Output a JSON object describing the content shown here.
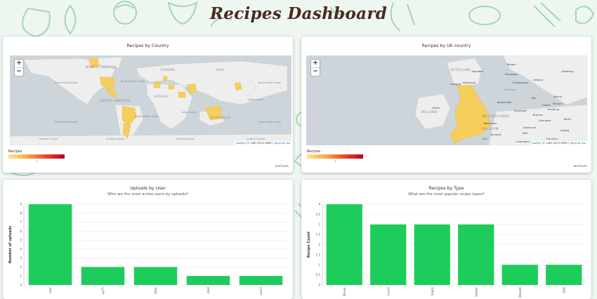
{
  "page": {
    "title": "Recipes Dashboard"
  },
  "colors": {
    "bar": "#1ecc5c",
    "doodle": "#7fc59a",
    "title": "#4a2a22",
    "map_highlight": "#f5cf5c"
  },
  "maps": [
    {
      "title": "Recipes by Country",
      "zoom_in": "+",
      "zoom_out": "−",
      "attribution": {
        "prefix": "Leaflet",
        "middle": " | © 1987-2019 HERE | ",
        "terms": "Terms of use"
      },
      "legend": {
        "title": "Recipes",
        "tick": "1"
      },
      "brand": "amCharts",
      "labels": [
        {
          "text": "NORTH AMERICA",
          "cls": "big"
        },
        {
          "text": "SOUTH AMERICA",
          "cls": "big"
        },
        {
          "text": "EUROPE",
          "cls": "big"
        },
        {
          "text": "ASIA",
          "cls": "big"
        },
        {
          "text": "AFRICA",
          "cls": "big"
        },
        {
          "text": "AUSTRALIA",
          "cls": "big"
        },
        {
          "text": "North Pacific Ocean",
          "cls": "sea"
        },
        {
          "text": "South Pacific Ocean",
          "cls": "sea"
        },
        {
          "text": "North Atlantic Ocean",
          "cls": "sea"
        },
        {
          "text": "South Atlantic Ocean",
          "cls": "sea"
        },
        {
          "text": "Indian Ocean",
          "cls": "sea"
        },
        {
          "text": "North Pacific Ocean",
          "cls": "sea"
        },
        {
          "text": "South Pacific Ocean",
          "cls": "sea"
        },
        {
          "text": "Indian Ocean",
          "cls": "sea"
        },
        {
          "text": "Southern Ocean",
          "cls": "sea"
        },
        {
          "text": "Southern Ocean",
          "cls": "sea"
        },
        {
          "text": "Southern Ocean",
          "cls": "sea"
        },
        {
          "text": "Southern Ocean",
          "cls": "sea"
        }
      ]
    },
    {
      "title": "Recipes by UK country",
      "zoom_in": "+",
      "zoom_out": "−",
      "attribution": {
        "prefix": "Leaflet",
        "middle": " | © 1987-2019 HERE | ",
        "terms": "Terms of use"
      },
      "legend": {
        "title": "Recipes",
        "tick": "1"
      },
      "brand": "amCharts",
      "labels": [
        {
          "text": "SCOTLAND",
          "cls": "big"
        },
        {
          "text": "IRELAND",
          "cls": "big"
        },
        {
          "text": "NETHERLANDS",
          "cls": "big"
        },
        {
          "text": "BELGIUM",
          "cls": "big"
        },
        {
          "text": "North Sea",
          "cls": "sea"
        },
        {
          "text": "Glasgow",
          "cls": "city"
        },
        {
          "text": "Edinburgh",
          "cls": "city"
        },
        {
          "text": "Dublin",
          "cls": "city"
        },
        {
          "text": "Amsterdam",
          "cls": "city"
        },
        {
          "text": "Hamburg",
          "cls": "city"
        },
        {
          "text": "Bremen",
          "cls": "city"
        },
        {
          "text": "Hannover",
          "cls": "city"
        },
        {
          "text": "Berlin",
          "cls": "city"
        },
        {
          "text": "Rotterdam",
          "cls": "city"
        },
        {
          "text": "Dortmund",
          "cls": "city"
        },
        {
          "text": "Leipzig",
          "cls": "city"
        },
        {
          "text": "Brussels",
          "cls": "city"
        },
        {
          "text": "Köln",
          "cls": "city"
        },
        {
          "text": "Aberdeen",
          "cls": "city"
        },
        {
          "text": "Göteborg",
          "cls": "city"
        },
        {
          "text": "Malmö",
          "cls": "city"
        },
        {
          "text": "Kiel",
          "cls": "city"
        },
        {
          "text": "Aalborg",
          "cls": "city"
        },
        {
          "text": "Kristiansand",
          "cls": "city"
        },
        {
          "text": "Stavanger",
          "cls": "city"
        },
        {
          "text": "Bergen",
          "cls": "city"
        },
        {
          "text": "Rostock",
          "cls": "city"
        },
        {
          "text": "Lübeck",
          "cls": "city"
        },
        {
          "text": "Groningen",
          "cls": "city"
        },
        {
          "text": "Luxembourg",
          "cls": "city"
        },
        {
          "text": "Lille",
          "cls": "city"
        },
        {
          "text": "Frankfurt",
          "cls": "city"
        }
      ]
    }
  ],
  "chart_data": [
    {
      "type": "bar",
      "title": "Uploads by User",
      "subtitle": "Who are the most active users by uploads?",
      "ylabel": "Number of uploads",
      "categories": [
        "user",
        "eg71",
        "jdfdc",
        "cbell",
        "user2"
      ],
      "values": [
        9,
        2,
        2,
        1,
        1
      ],
      "ylim": [
        0,
        9
      ],
      "yticks": [
        "0",
        "1",
        "2",
        "3",
        "4",
        "5",
        "6",
        "7",
        "8",
        "9"
      ],
      "grid": true
    },
    {
      "type": "bar",
      "title": "Recipes by Type",
      "subtitle": "What are the most popular recipe types?",
      "ylabel": "Recipe Count",
      "categories": [
        "Dinner",
        "Lunch",
        "Snack",
        "Starter",
        "Dessert",
        "Side"
      ],
      "values": [
        4,
        3,
        3,
        3,
        1,
        1
      ],
      "ylim": [
        0,
        4
      ],
      "yticks": [
        "0",
        "0.5",
        "1",
        "1.5",
        "2",
        "2.5",
        "3",
        "3.5",
        "4"
      ],
      "grid": true
    }
  ]
}
